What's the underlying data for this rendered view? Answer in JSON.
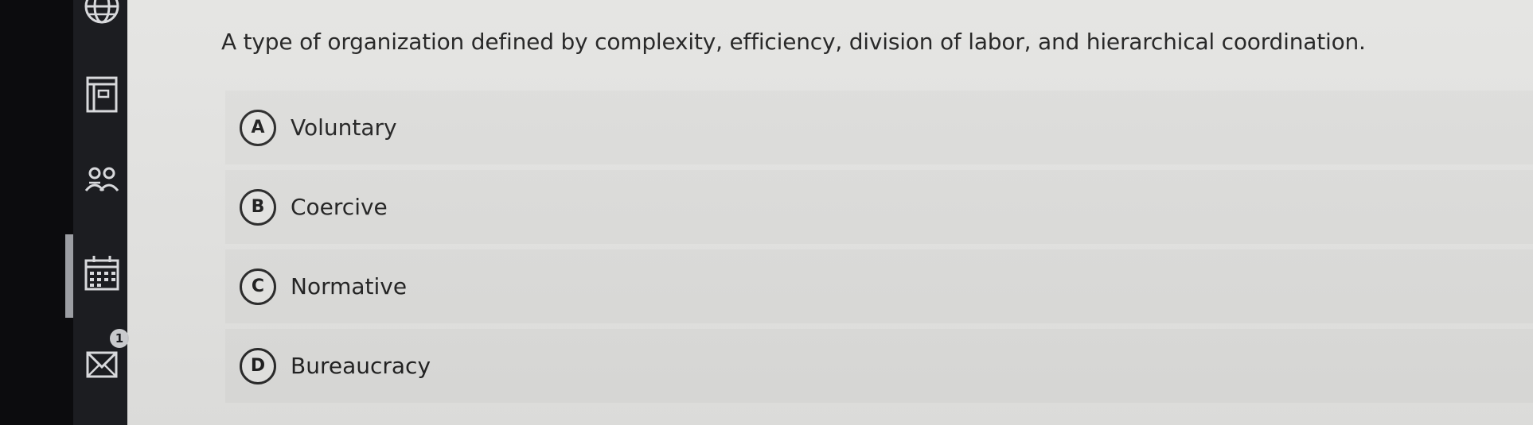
{
  "sidebar": {
    "icons": [
      "globe-icon",
      "document-panel-icon",
      "people-icon",
      "calendar-icon",
      "mail-icon"
    ],
    "mail_badge": "1"
  },
  "question": {
    "text": "A type of organization defined by complexity, efficiency, division of labor, and hierarchical coordination."
  },
  "choices": [
    {
      "letter": "A",
      "label": "Voluntary"
    },
    {
      "letter": "B",
      "label": "Coercive"
    },
    {
      "letter": "C",
      "label": "Normative"
    },
    {
      "letter": "D",
      "label": "Bureaucracy"
    }
  ]
}
